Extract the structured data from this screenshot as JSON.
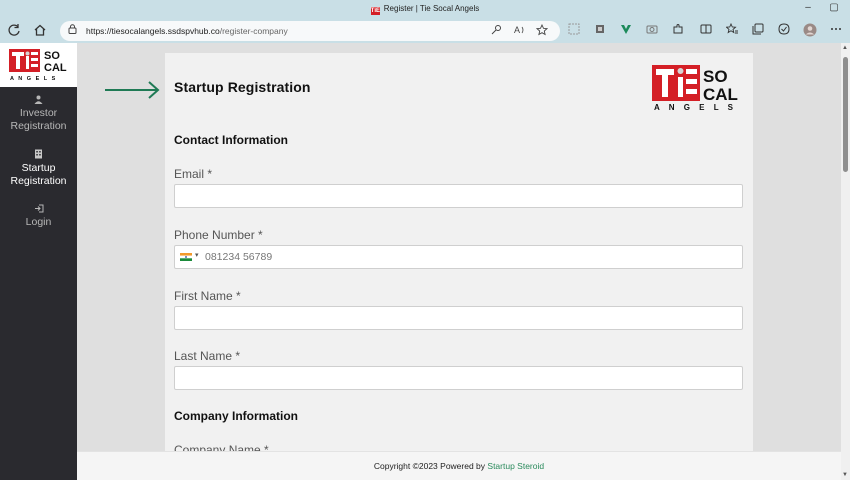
{
  "window": {
    "title": "Register | Tie Socal Angels",
    "favicon_text": "TiE",
    "controls": {
      "minimize": "–",
      "restore": "▢"
    }
  },
  "toolbar": {
    "url_host": "https://tiesocalangels.ssdspvhub.co",
    "url_path": "/register-company",
    "icons": [
      "refresh-icon",
      "home-icon",
      "lock-icon",
      "key-icon",
      "read-aloud-icon",
      "favorite-star-icon",
      "extension-icons",
      "split-screen-icon",
      "favorites-icon",
      "collections-icon",
      "browser-essentials-icon",
      "profile-icon",
      "more-icon"
    ]
  },
  "logo": {
    "small": {
      "tie": "TiE",
      "so": "SO",
      "cal": "CAL",
      "angels": "A N G E L S"
    },
    "large": {
      "tie": "TiE",
      "so": "SO",
      "cal": "CAL",
      "angels": "A N G E L S"
    },
    "red": "#d41f26"
  },
  "sidebar": {
    "items": [
      {
        "icon": "user-icon",
        "label": "Investor Registration",
        "active": false
      },
      {
        "icon": "building-icon",
        "label": "Startup Registration",
        "active": true
      },
      {
        "icon": "login-icon",
        "label": "Login",
        "active": false
      }
    ]
  },
  "form": {
    "title": "Startup Registration",
    "contact_section": "Contact Information",
    "email_label": "Email *",
    "email_value": "",
    "phone_label": "Phone Number *",
    "phone_placeholder": "081234 56789",
    "phone_country": "India",
    "first_name_label": "First Name *",
    "first_name_value": "",
    "last_name_label": "Last Name *",
    "last_name_value": "",
    "company_section": "Company Information",
    "company_name_label": "Company Name *"
  },
  "footer": {
    "text": "Copyright ©2023 Powered by ",
    "link": "Startup Steroid"
  },
  "colors": {
    "sidebar_bg": "#2a2a2f",
    "accent_green": "#2a8a5c",
    "arrow_green": "#1f7a55",
    "browser_chrome": "#c9dfe6"
  }
}
